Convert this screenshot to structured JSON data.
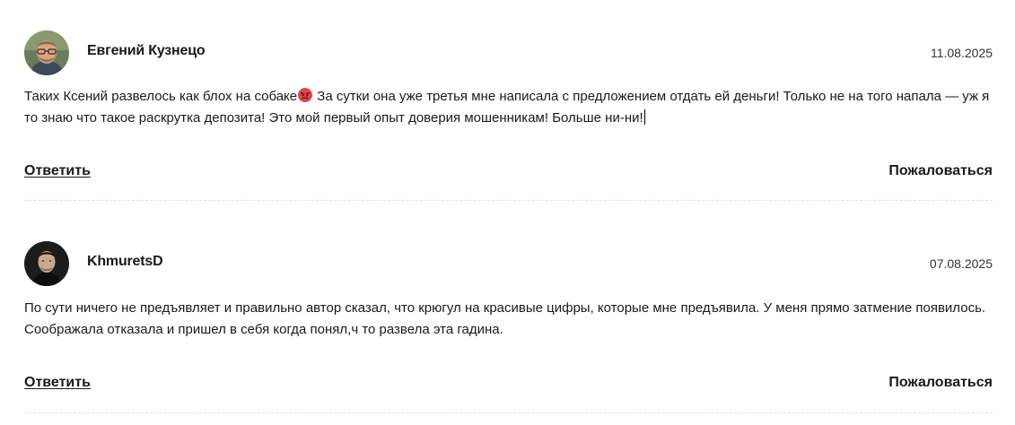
{
  "comments": [
    {
      "author": "Евгений Кузнецо",
      "date": "11.08.2025",
      "text_before_emoji": "Таких Ксений развелось как блох на собаке",
      "emoji": "angry-face-emoji",
      "text_after_emoji": " За сутки она уже третья мне написала с предложением отдать ей деньги! Только не на того напала — уж я то знаю что такое раскрутка депозита! Это мой первый опыт доверия мошенникам! Больше ни-ни!",
      "reply_label": "Ответить",
      "report_label": "Пожаловаться",
      "avatar": "avatar-man-glasses"
    },
    {
      "author": "KhmuretsD",
      "date": "07.08.2025",
      "text": "По сути ничего не предъявляет и правильно автор сказал, что крюгул на красивые цифры, которые мне предъявила. У меня прямо затмение появилось. Соображала отказала и пришел в себя когда понял,ч то развела эта гадина.",
      "reply_label": "Ответить",
      "report_label": "Пожаловаться",
      "avatar": "avatar-man-dark"
    }
  ],
  "colors": {
    "text": "#1a1a1a",
    "date": "#333333",
    "divider": "#e4e4e4",
    "emoji": "#e0484f"
  }
}
